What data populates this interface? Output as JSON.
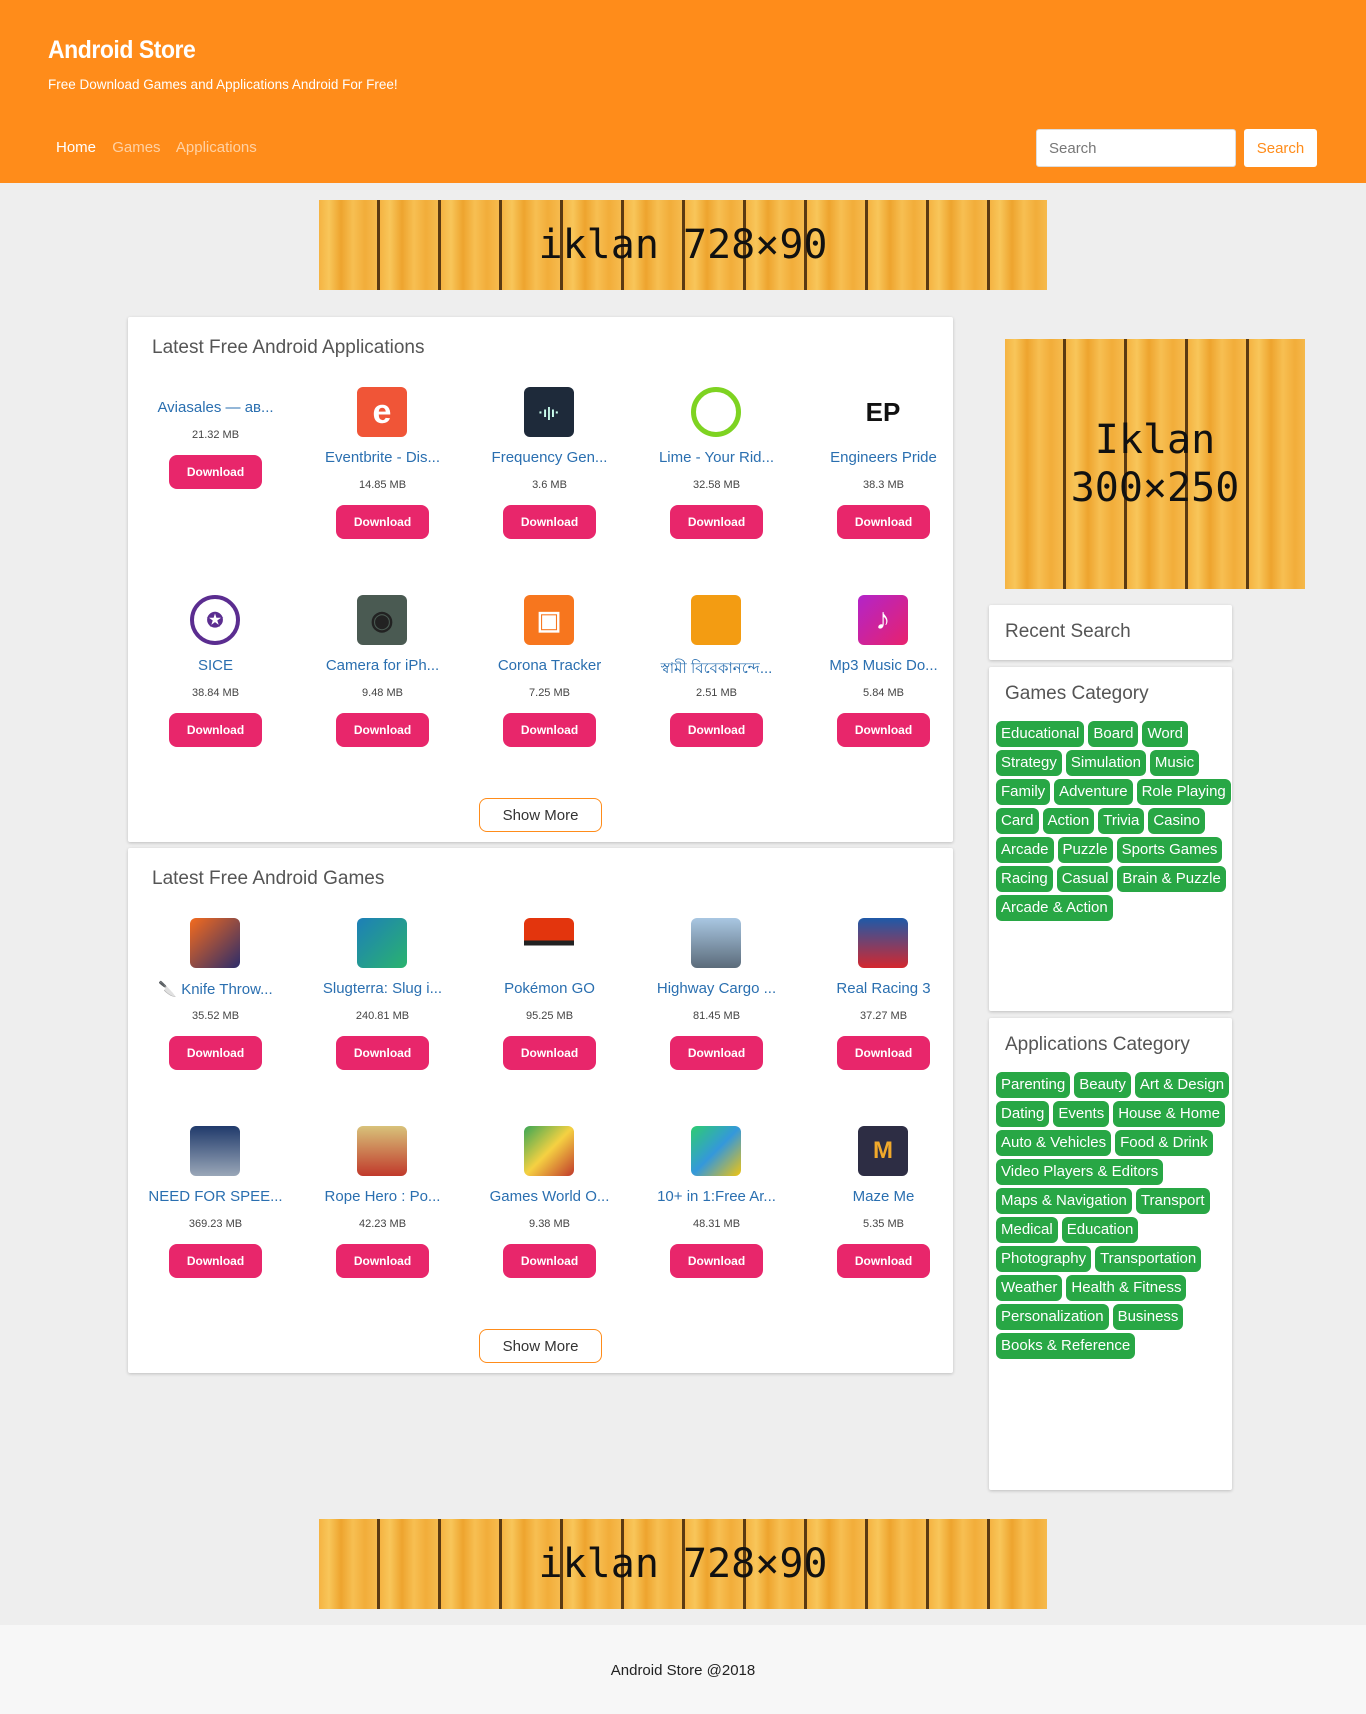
{
  "header": {
    "brand": "Android Store",
    "tagline": "Free Download Games and Applications Android For Free!",
    "nav": [
      {
        "label": "Home",
        "active": true
      },
      {
        "label": "Games"
      },
      {
        "label": "Applications"
      }
    ],
    "search_placeholder": "Search",
    "search_button": "Search",
    "color": "#ff8c1a"
  },
  "ads": {
    "top": "iklan 728×90",
    "side_line1": "Iklan",
    "side_line2": "300×250",
    "bottom": "iklan 728×90"
  },
  "apps_section": {
    "title": "Latest Free Android Applications",
    "items": [
      {
        "name": "Aviasales — ав...",
        "size": "21.32 MB",
        "icon": "none"
      },
      {
        "name": "Eventbrite - Dis...",
        "size": "14.85 MB",
        "icon": "eventbrite-icon"
      },
      {
        "name": "Frequency Gen...",
        "size": "3.6 MB",
        "icon": "frequency-icon"
      },
      {
        "name": "Lime - Your Rid...",
        "size": "32.58 MB",
        "icon": "lime-icon"
      },
      {
        "name": "Engineers Pride",
        "size": "38.3 MB",
        "icon": "ep-icon"
      },
      {
        "name": "SICE",
        "size": "38.84 MB",
        "icon": "police-icon"
      },
      {
        "name": "Camera for iPh...",
        "size": "9.48 MB",
        "icon": "camera-icon"
      },
      {
        "name": "Corona Tracker",
        "size": "7.25 MB",
        "icon": "android-icon"
      },
      {
        "name": "স্বামী বিবেকানন্দে...",
        "size": "2.51 MB",
        "icon": "vivekananda-icon"
      },
      {
        "name": "Mp3 Music Do...",
        "size": "5.84 MB",
        "icon": "music-icon"
      }
    ],
    "download_label": "Download",
    "show_more": "Show More"
  },
  "games_section": {
    "title": "Latest Free Android Games",
    "items": [
      {
        "name": "🔪 Knife Throw...",
        "size": "35.52 MB",
        "icon": "knife-icon"
      },
      {
        "name": "Slugterra: Slug i...",
        "size": "240.81 MB",
        "icon": "slugterra-icon"
      },
      {
        "name": "Pokémon GO",
        "size": "95.25 MB",
        "icon": "pokeball-icon"
      },
      {
        "name": "Highway Cargo ...",
        "size": "81.45 MB",
        "icon": "truck-icon"
      },
      {
        "name": "Real Racing 3",
        "size": "37.27 MB",
        "icon": "racing-icon"
      },
      {
        "name": "NEED FOR SPEE...",
        "size": "369.23 MB",
        "icon": "nfs-icon"
      },
      {
        "name": "Rope Hero : Po...",
        "size": "42.23 MB",
        "icon": "rope-hero-icon"
      },
      {
        "name": "Games World O...",
        "size": "9.38 MB",
        "icon": "games-world-icon"
      },
      {
        "name": "10+ in 1:Free Ar...",
        "size": "48.31 MB",
        "icon": "arcade-icon"
      },
      {
        "name": "Maze Me",
        "size": "5.35 MB",
        "icon": "maze-icon"
      }
    ],
    "download_label": "Download",
    "show_more": "Show More"
  },
  "sidebar": {
    "recent_search_title": "Recent Search",
    "games_category_title": "Games Category",
    "games_categories": [
      "Educational",
      "Board",
      "Word",
      "Strategy",
      "Simulation",
      "Music",
      "Family",
      "Adventure",
      "Role Playing",
      "Card",
      "Action",
      "Trivia",
      "Casino",
      "Arcade",
      "Puzzle",
      "Sports Games",
      "Racing",
      "Casual",
      "Brain & Puzzle",
      "Arcade & Action"
    ],
    "apps_category_title": "Applications Category",
    "apps_categories": [
      "Parenting",
      "Beauty",
      "Art & Design",
      "Dating",
      "Events",
      "House & Home",
      "Auto & Vehicles",
      "Food & Drink",
      "Video Players & Editors",
      "Maps & Navigation",
      "Transport",
      "Medical",
      "Education",
      "Photography",
      "Transportation",
      "Weather",
      "Health & Fitness",
      "Personalization",
      "Business",
      "Books & Reference"
    ],
    "tag_color": "#28a745"
  },
  "footer": {
    "text": "Android Store @2018"
  }
}
